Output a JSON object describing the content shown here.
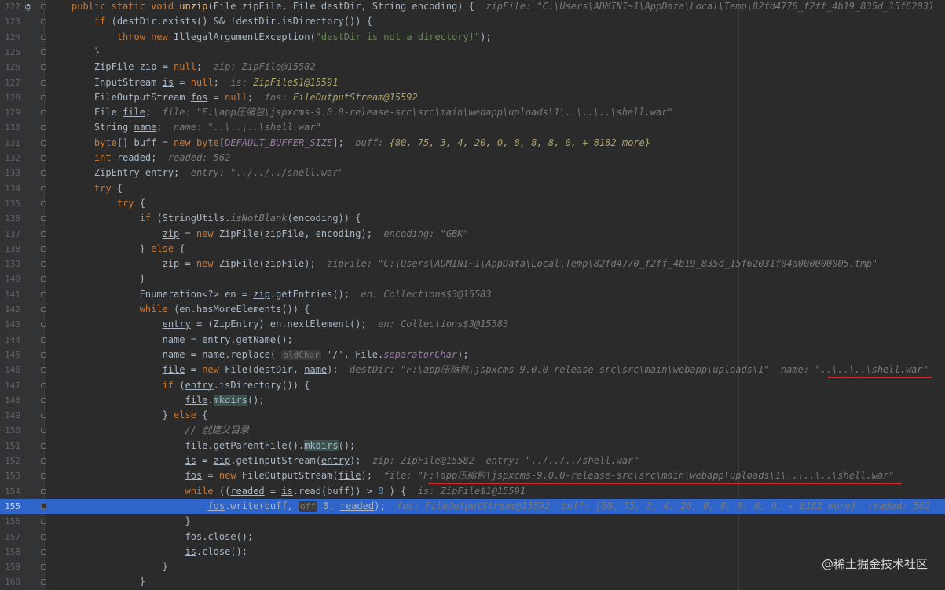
{
  "lines": [
    {
      "n": "122",
      "segs": [
        [
          "kw",
          "public static void "
        ],
        [
          "fn",
          "unzip"
        ],
        [
          "",
          "(File zipFile, File destDir, String encoding) {  "
        ],
        [
          "hint",
          "zipFile: \"C:\\Users\\ADMINI~1\\AppData\\Local\\Temp\\82fd4770_f2ff_4b19_835d_15f62031"
        ]
      ],
      "gutter": "@"
    },
    {
      "n": "123",
      "segs": [
        [
          "",
          "    "
        ],
        [
          "kw",
          "if "
        ],
        [
          "",
          "(destDir.exists() && !destDir.isDirectory()) {"
        ]
      ]
    },
    {
      "n": "124",
      "segs": [
        [
          "",
          "        "
        ],
        [
          "kw",
          "throw new "
        ],
        [
          "",
          "IllegalArgumentException("
        ],
        [
          "str",
          "\"destDir is not a directory!\""
        ],
        [
          "",
          ");"
        ]
      ]
    },
    {
      "n": "125",
      "segs": [
        [
          "",
          "    }"
        ]
      ]
    },
    {
      "n": "126",
      "segs": [
        [
          "",
          "    ZipFile "
        ],
        [
          "ul",
          "zip"
        ],
        [
          "",
          " = "
        ],
        [
          "kw",
          "null"
        ],
        [
          "",
          ";  "
        ],
        [
          "hint",
          "zip: ZipFile@15582"
        ]
      ]
    },
    {
      "n": "127",
      "segs": [
        [
          "",
          "    InputStream "
        ],
        [
          "ul",
          "is"
        ],
        [
          "",
          " = "
        ],
        [
          "kw",
          "null"
        ],
        [
          "",
          ";  "
        ],
        [
          "hint",
          "is: "
        ],
        [
          "hintv",
          "ZipFile$1@15591"
        ]
      ]
    },
    {
      "n": "128",
      "segs": [
        [
          "",
          "    FileOutputStream "
        ],
        [
          "ul",
          "fos"
        ],
        [
          "",
          " = "
        ],
        [
          "kw",
          "null"
        ],
        [
          "",
          ";  "
        ],
        [
          "hint",
          "fos: "
        ],
        [
          "hintv",
          "FileOutputStream@15592"
        ]
      ]
    },
    {
      "n": "129",
      "segs": [
        [
          "",
          "    File "
        ],
        [
          "ul",
          "file"
        ],
        [
          "",
          ";  "
        ],
        [
          "hint",
          "file: \"F:\\app压缩包\\jspxcms-9.0.0-release-src\\src\\main\\webapp\\uploads\\1\\..\\..\\..\\shell.war\""
        ]
      ]
    },
    {
      "n": "130",
      "segs": [
        [
          "",
          "    String "
        ],
        [
          "ul",
          "name"
        ],
        [
          "",
          ";  "
        ],
        [
          "hint",
          "name: \"..\\..\\..\\shell.war\""
        ]
      ]
    },
    {
      "n": "131",
      "segs": [
        [
          "",
          "    "
        ],
        [
          "kw",
          "byte"
        ],
        [
          "",
          "[] buff = "
        ],
        [
          "kw",
          "new byte"
        ],
        [
          "",
          "["
        ],
        [
          "cn",
          "DEFAULT_BUFFER_SIZE"
        ],
        [
          "",
          "];  "
        ],
        [
          "hint",
          "buff: "
        ],
        [
          "hintv",
          "{80, 75, 3, 4, 20, 0, 8, 8, 8, 0, + 8182 more}"
        ]
      ]
    },
    {
      "n": "132",
      "segs": [
        [
          "",
          "    "
        ],
        [
          "kw",
          "int "
        ],
        [
          "ul",
          "readed"
        ],
        [
          "",
          ";  "
        ],
        [
          "hint",
          "readed: 562"
        ]
      ]
    },
    {
      "n": "133",
      "segs": [
        [
          "",
          "    ZipEntry "
        ],
        [
          "ul",
          "entry"
        ],
        [
          "",
          ";  "
        ],
        [
          "hint",
          "entry: \"../../../shell.war\""
        ]
      ]
    },
    {
      "n": "134",
      "segs": [
        [
          "",
          "    "
        ],
        [
          "kw",
          "try "
        ],
        [
          "",
          "{"
        ]
      ]
    },
    {
      "n": "135",
      "segs": [
        [
          "",
          "        "
        ],
        [
          "kw",
          "try "
        ],
        [
          "",
          "{"
        ]
      ]
    },
    {
      "n": "136",
      "segs": [
        [
          "",
          "            "
        ],
        [
          "kw",
          "if "
        ],
        [
          "",
          "(StringUtils."
        ],
        [
          "cm",
          "isNotBlank"
        ],
        [
          "",
          "(encoding)) {"
        ]
      ]
    },
    {
      "n": "137",
      "segs": [
        [
          "",
          "                "
        ],
        [
          "ul",
          "zip"
        ],
        [
          "",
          " = "
        ],
        [
          "kw",
          "new "
        ],
        [
          "",
          "ZipFile(zipFile, encoding);  "
        ],
        [
          "hint",
          "encoding: \"GBK\""
        ]
      ]
    },
    {
      "n": "138",
      "segs": [
        [
          "",
          "            } "
        ],
        [
          "kw",
          "else "
        ],
        [
          "",
          "{"
        ]
      ]
    },
    {
      "n": "139",
      "segs": [
        [
          "",
          "                "
        ],
        [
          "ul",
          "zip"
        ],
        [
          "",
          " = "
        ],
        [
          "kw",
          "new "
        ],
        [
          "",
          "ZipFile(zipFile);  "
        ],
        [
          "hint",
          "zipFile: \"C:\\Users\\ADMINI~1\\AppData\\Local\\Temp\\82fd4770_f2ff_4b19_835d_15f62031f04a000000005.tmp\""
        ]
      ]
    },
    {
      "n": "140",
      "segs": [
        [
          "",
          "            }"
        ]
      ]
    },
    {
      "n": "141",
      "segs": [
        [
          "",
          "            Enumeration<?> en = "
        ],
        [
          "ul",
          "zip"
        ],
        [
          "",
          ".getEntries();  "
        ],
        [
          "hint",
          "en: Collections$3@15583"
        ]
      ]
    },
    {
      "n": "142",
      "segs": [
        [
          "",
          "            "
        ],
        [
          "kw",
          "while "
        ],
        [
          "",
          "(en.hasMoreElements()) {"
        ]
      ]
    },
    {
      "n": "143",
      "segs": [
        [
          "",
          "                "
        ],
        [
          "ul",
          "entry"
        ],
        [
          "",
          " = (ZipEntry) en.nextElement();  "
        ],
        [
          "hint",
          "en: Collections$3@15583"
        ]
      ]
    },
    {
      "n": "144",
      "segs": [
        [
          "",
          "                "
        ],
        [
          "ul",
          "name"
        ],
        [
          "",
          " = "
        ],
        [
          "ul",
          "entry"
        ],
        [
          "",
          ".getName();"
        ]
      ]
    },
    {
      "n": "145",
      "segs": [
        [
          "",
          "                "
        ],
        [
          "ul",
          "name"
        ],
        [
          "",
          " = "
        ],
        [
          "ul",
          "name"
        ],
        [
          "",
          ".replace( "
        ],
        [
          "param",
          "oldChar"
        ],
        [
          "",
          " '/', File."
        ],
        [
          "cn",
          "separatorChar"
        ],
        [
          "",
          ");"
        ]
      ]
    },
    {
      "n": "146",
      "segs": [
        [
          "",
          "                "
        ],
        [
          "ul",
          "file"
        ],
        [
          "",
          " = "
        ],
        [
          "kw",
          "new "
        ],
        [
          "",
          "File(destDir, "
        ],
        [
          "ul",
          "name"
        ],
        [
          "",
          ");  "
        ],
        [
          "hint",
          "destDir: \"F:\\app压缩包\\jspxcms-9.0.0-release-src\\src\\main\\webapp\\uploads\\1\"  name: \"..\\..\\..\\shell.war\""
        ]
      ]
    },
    {
      "n": "147",
      "segs": [
        [
          "",
          "                "
        ],
        [
          "kw",
          "if "
        ],
        [
          "",
          "("
        ],
        [
          "ul",
          "entry"
        ],
        [
          "",
          ".isDirectory()) {"
        ]
      ]
    },
    {
      "n": "148",
      "segs": [
        [
          "",
          "                    "
        ],
        [
          "ul",
          "file"
        ],
        [
          "",
          "."
        ],
        [
          "mk",
          "mkdirs"
        ],
        [
          "",
          "();"
        ]
      ]
    },
    {
      "n": "149",
      "segs": [
        [
          "",
          "                } "
        ],
        [
          "kw",
          "else "
        ],
        [
          "",
          "{"
        ]
      ]
    },
    {
      "n": "150",
      "segs": [
        [
          "",
          "                    "
        ],
        [
          "cm",
          "// 创建父目录"
        ]
      ]
    },
    {
      "n": "151",
      "segs": [
        [
          "",
          "                    "
        ],
        [
          "ul",
          "file"
        ],
        [
          "",
          ".getParentFile()."
        ],
        [
          "mk",
          "mkdirs"
        ],
        [
          "",
          "();"
        ]
      ]
    },
    {
      "n": "152",
      "segs": [
        [
          "",
          "                    "
        ],
        [
          "ul",
          "is"
        ],
        [
          "",
          " = "
        ],
        [
          "ul",
          "zip"
        ],
        [
          "",
          ".getInputStream("
        ],
        [
          "ul",
          "entry"
        ],
        [
          "",
          ");  "
        ],
        [
          "hint",
          "zip: ZipFile@15582  entry: \"../../../shell.war\""
        ]
      ]
    },
    {
      "n": "153",
      "segs": [
        [
          "",
          "                    "
        ],
        [
          "ul",
          "fos"
        ],
        [
          "",
          " = "
        ],
        [
          "kw",
          "new "
        ],
        [
          "",
          "FileOutputStream("
        ],
        [
          "ul",
          "file"
        ],
        [
          "",
          ");  "
        ],
        [
          "hint",
          "file: \"F:\\app压缩包\\jspxcms-9.0.0-release-src\\src\\main\\webapp\\uploads\\1\\..\\..\\..\\shell.war\""
        ]
      ]
    },
    {
      "n": "154",
      "segs": [
        [
          "",
          "                    "
        ],
        [
          "kw",
          "while "
        ],
        [
          "",
          "(("
        ],
        [
          "ul",
          "readed"
        ],
        [
          "",
          " = "
        ],
        [
          "ul",
          "is"
        ],
        [
          "",
          ".read(buff)) > "
        ],
        [
          "num",
          "0"
        ],
        [
          "",
          " ) {  "
        ],
        [
          "hint",
          "is: ZipFile$1@15591"
        ]
      ]
    },
    {
      "n": "155",
      "segs": [
        [
          "",
          "                        "
        ],
        [
          "ul",
          "fos"
        ],
        [
          "",
          ".write(buff, "
        ],
        [
          "param",
          "off"
        ],
        [
          "",
          " 0, "
        ],
        [
          "ul",
          "readed"
        ],
        [
          "",
          ");  "
        ],
        [
          "hint",
          "fos: FileOutputStream@15592  buff: {80, 75, 3, 4, 20, 0, 8, 8, 8, 0, + 8182 more}  readed: 562"
        ]
      ],
      "hl": true
    },
    {
      "n": "156",
      "segs": [
        [
          "",
          "                    }"
        ]
      ]
    },
    {
      "n": "157",
      "segs": [
        [
          "",
          "                    "
        ],
        [
          "ul",
          "fos"
        ],
        [
          "",
          ".close();"
        ]
      ]
    },
    {
      "n": "158",
      "segs": [
        [
          "",
          "                    "
        ],
        [
          "ul",
          "is"
        ],
        [
          "",
          ".close();"
        ]
      ]
    },
    {
      "n": "159",
      "segs": [
        [
          "",
          "                }"
        ]
      ]
    },
    {
      "n": "160",
      "segs": [
        [
          "",
          "            }"
        ]
      ]
    }
  ],
  "watermark": "@稀土掘金技术社区"
}
